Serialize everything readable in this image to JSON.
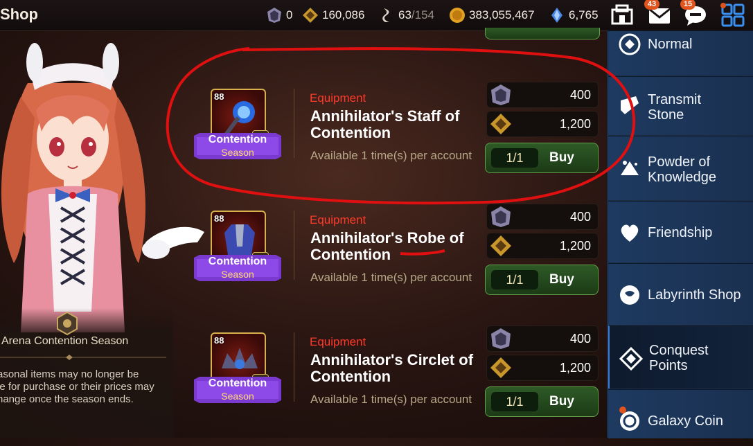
{
  "header": {
    "title": "Shop",
    "resources": [
      {
        "icon": "arena-flag-icon",
        "value": "0"
      },
      {
        "icon": "conquest-points-icon",
        "value": "160,086"
      },
      {
        "icon": "stamina-icon",
        "value": "63",
        "max": "/154"
      },
      {
        "icon": "gold-coin-icon",
        "value": "383,055,467"
      },
      {
        "icon": "skystone-icon",
        "value": "6,765"
      }
    ],
    "buttons": [
      {
        "icon": "sanctuary-icon",
        "badge": ""
      },
      {
        "icon": "mail-icon",
        "badge": "43"
      },
      {
        "icon": "chat-icon",
        "badge": "15"
      },
      {
        "icon": "menu-grid-icon",
        "badge": ""
      }
    ]
  },
  "season": {
    "name": "Arena Contention Season",
    "description": "asonal items may no longer be\nle for purchase or their prices may\nhange once the season ends."
  },
  "items": [
    {
      "level": "88",
      "icon": "staff-icon",
      "ribbon_main": "Contention",
      "ribbon_sub": "Season",
      "category": "Equipment",
      "name_line1": "Annihilator's Staff of",
      "name_line2": "Contention",
      "availability": "Available 1 time(s) per account",
      "cost1": "400",
      "cost2": "1,200",
      "quantity": "1/1",
      "buy_label": "Buy"
    },
    {
      "level": "88",
      "icon": "robe-icon",
      "ribbon_main": "Contention",
      "ribbon_sub": "Season",
      "category": "Equipment",
      "name_line1": "Annihilator's Robe of",
      "name_line2": "Contention",
      "availability": "Available 1 time(s) per account",
      "cost1": "400",
      "cost2": "1,200",
      "quantity": "1/1",
      "buy_label": "Buy"
    },
    {
      "level": "88",
      "icon": "circlet-icon",
      "ribbon_main": "Contention",
      "ribbon_sub": "Season",
      "category": "Equipment",
      "name_line1": "Annihilator's Circlet of",
      "name_line2": "Contention",
      "availability": "Available 1 time(s) per account",
      "cost1": "400",
      "cost2": "1,200",
      "quantity": "1/1",
      "buy_label": "Buy"
    }
  ],
  "sidebar": {
    "items": [
      {
        "label": "Normal",
        "icon": "normal-shop-icon",
        "active": false
      },
      {
        "label": "Transmit Stone",
        "icon": "transmit-stone-icon",
        "active": false
      },
      {
        "label": "Powder of Knowledge",
        "icon": "powder-icon",
        "active": false
      },
      {
        "label": "Friendship",
        "icon": "heart-icon",
        "active": false
      },
      {
        "label": "Labyrinth Shop",
        "icon": "labyrinth-icon",
        "active": false
      },
      {
        "label": "Conquest Points",
        "icon": "conquest-icon",
        "active": true
      },
      {
        "label": "Galaxy Coin",
        "icon": "galaxy-coin-icon",
        "active": false
      }
    ]
  },
  "colors": {
    "accent_red": "#ff3a2a",
    "ribbon_purple": "#7a3ad0",
    "buy_green": "#2e5a26",
    "sidebar_blue": "#1e3a60",
    "annotation_red": "#e01010"
  }
}
